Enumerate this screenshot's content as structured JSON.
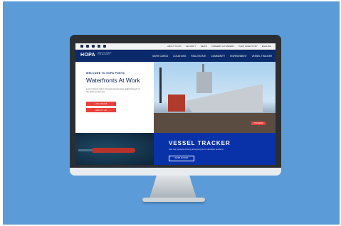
{
  "site": {
    "logo": "HOPA",
    "logo_sub": "HAMILTON OSHAWA PORT AUTHORITY"
  },
  "utility_nav": [
    "ABOUT HOPA",
    "SECURITY",
    "NEWS",
    "CAREERS & TENDERS",
    "PORT DIRECTORY",
    "ENGLISH"
  ],
  "main_nav": [
    "MOVE CARGO",
    "LOCATIONS",
    "REAL ESTATE",
    "COMMUNITY",
    "ENVIRONMENT",
    "VESSEL TRACKER"
  ],
  "hero": {
    "eyebrow": "WELCOME TO HOPA PORTS",
    "title": "Waterfronts At Work",
    "paragraph": "Lorem ipsum dolor sit amet praesenteas adipiscing elit ut ulo tellus cursus leo.",
    "button_1": "LOCATIONS",
    "button_2": "ABOUT US",
    "image_button": "PROGRAM"
  },
  "vessel": {
    "title": "VESSEL TRACKER",
    "subtitle": "See the vessels coming and going from Hamilton Harbour",
    "button": "SHIPS IN PORT"
  },
  "colors": {
    "navy": "#0b2a6b",
    "accent_red": "#e8403a",
    "vessel_blue": "#0a32a8",
    "background": "#5b9bd8"
  }
}
